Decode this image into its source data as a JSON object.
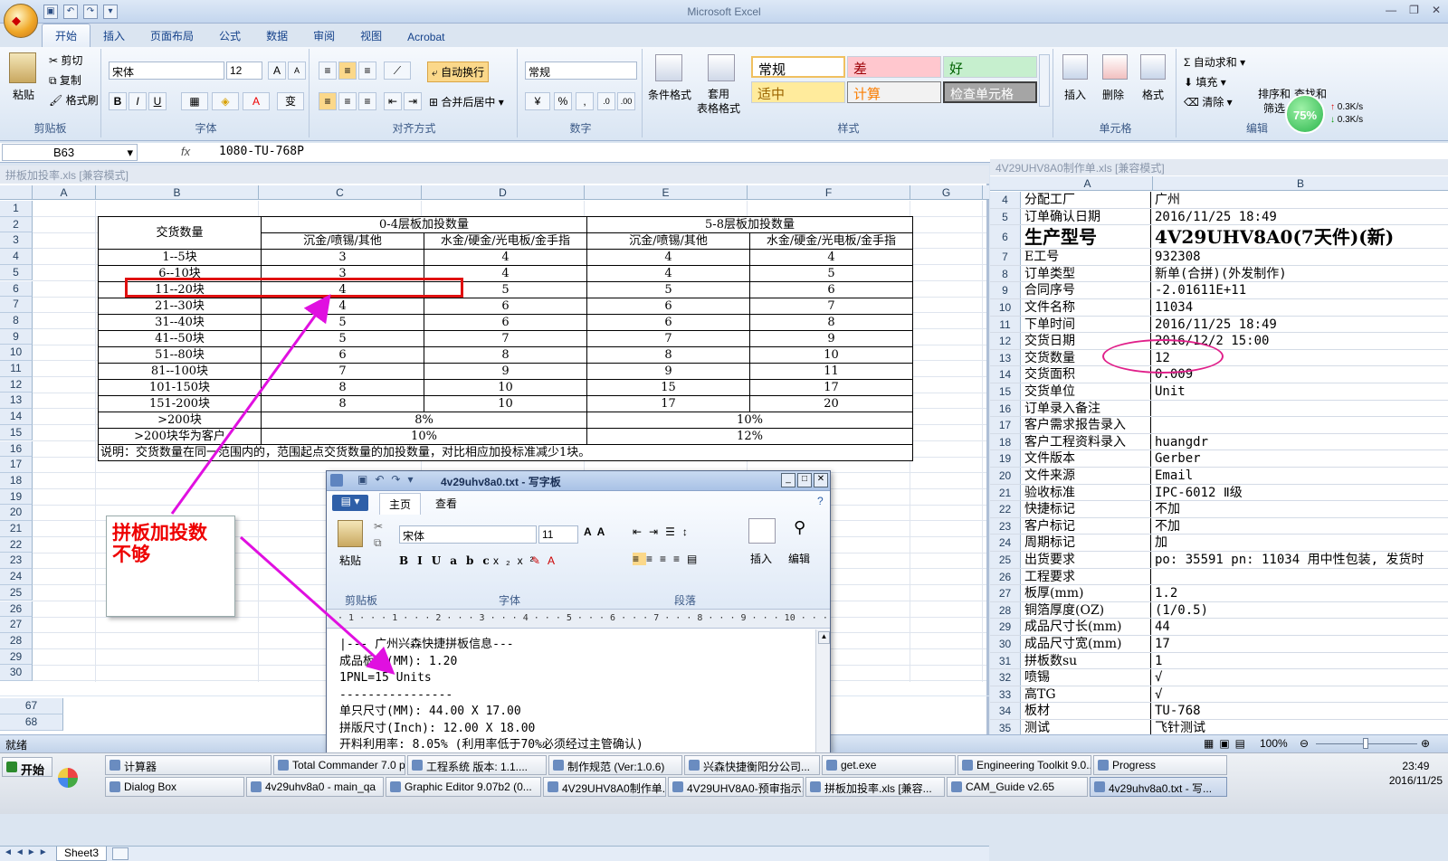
{
  "app": {
    "title": "Microsoft Excel",
    "office_button": "Office"
  },
  "ribbon": {
    "tabs": [
      "开始",
      "插入",
      "页面布局",
      "公式",
      "数据",
      "审阅",
      "视图",
      "Acrobat"
    ],
    "clipboard": {
      "paste": "粘贴",
      "cut": "剪切",
      "copy": "复制",
      "format_painter": "格式刷",
      "label": "剪贴板"
    },
    "font": {
      "name": "宋体",
      "size": "12",
      "label": "字体"
    },
    "alignment": {
      "wrap": "自动换行",
      "merge": "合并后居中",
      "label": "对齐方式"
    },
    "number": {
      "format": "常规",
      "label": "数字"
    },
    "styles": {
      "conditional": "条件格式",
      "table": "套用\n表格格式",
      "normal": "常规",
      "bad": "差",
      "good": "好",
      "neutral": "适中",
      "calc": "计算",
      "check": "检查单元格",
      "label": "样式"
    },
    "cells": {
      "insert": "插入",
      "delete": "删除",
      "format": "格式",
      "label": "单元格"
    },
    "editing": {
      "autosum": "自动求和",
      "fill": "填充",
      "clear": "清除",
      "sort": "排序和\n筛选",
      "find": "查找和\n选择",
      "label": "编辑"
    }
  },
  "net": {
    "percent": "75%",
    "up": "0.3K/s",
    "down": "0.3K/s"
  },
  "formula_bar": {
    "namebox": "B63",
    "fx": "fx",
    "value": "1080-TU-768P"
  },
  "left_workbook": {
    "title": "拼板加投率.xls  [兼容模式]",
    "columns": [
      "A",
      "B",
      "C",
      "D",
      "E",
      "F",
      "G"
    ],
    "rows": [
      "1",
      "2",
      "3",
      "4",
      "5",
      "6",
      "7",
      "8",
      "9",
      "10",
      "11",
      "12",
      "13",
      "14",
      "15",
      "16",
      "17",
      "18",
      "19",
      "20",
      "21",
      "22",
      "23",
      "24",
      "25",
      "26",
      "27",
      "28",
      "29",
      "30"
    ],
    "header": {
      "qty": "交货数量",
      "g1": "0-4层板加投数量",
      "g2": "5-8层板加投数量",
      "c1": "沉金/喷锡/其他",
      "c2": "水金/硬金/光电板/金手指",
      "c3": "沉金/喷锡/其他",
      "c4": "水金/硬金/光电板/金手指"
    },
    "table": [
      [
        "1--5块",
        "3",
        "4",
        "4",
        "4"
      ],
      [
        "6--10块",
        "3",
        "4",
        "4",
        "5"
      ],
      [
        "11--20块",
        "4",
        "5",
        "5",
        "6"
      ],
      [
        "21--30块",
        "4",
        "6",
        "6",
        "7"
      ],
      [
        "31--40块",
        "5",
        "6",
        "6",
        "8"
      ],
      [
        "41--50块",
        "5",
        "7",
        "7",
        "9"
      ],
      [
        "51--80块",
        "6",
        "8",
        "8",
        "10"
      ],
      [
        "81--100块",
        "7",
        "9",
        "9",
        "11"
      ],
      [
        "101-150块",
        "8",
        "10",
        "15",
        "17"
      ],
      [
        "151-200块",
        "8",
        "10",
        "17",
        "20"
      ]
    ],
    "row14": {
      "qty": ">200块",
      "g1": "8%",
      "g2": "10%"
    },
    "row15": {
      "qty": ">200块华为客户",
      "g1": "10%",
      "g2": "12%"
    },
    "note": "说明：交货数量在同一范围内的，范围起点交货数量的加投数量，对比相应加投标准减少1块。",
    "sheet_tab": "Sheet3",
    "lower_rows": [
      "67",
      "68"
    ]
  },
  "callout": {
    "text": "拼板加投数\n不够"
  },
  "right_workbook": {
    "title": "4V29UHV8A0制作单.xls  [兼容模式]",
    "columns": [
      "A",
      "B"
    ],
    "rows": [
      {
        "n": "4",
        "a": "分配工厂",
        "b": "广州"
      },
      {
        "n": "5",
        "a": "订单确认日期",
        "b": "2016/11/25 18:49"
      },
      {
        "n": "6",
        "a": "生产型号",
        "b": "4V29UHV8A0(7天件)(新)"
      },
      {
        "n": "7",
        "a": "E工号",
        "b": "932308"
      },
      {
        "n": "8",
        "a": "订单类型",
        "b": "新单(合拼)(外发制作)"
      },
      {
        "n": "9",
        "a": "合同序号",
        "b": "-2.01611E+11"
      },
      {
        "n": "10",
        "a": "文件名称",
        "b": "11034"
      },
      {
        "n": "11",
        "a": "下单时间",
        "b": "2016/11/25 18:49"
      },
      {
        "n": "12",
        "a": "交货日期",
        "b": "2016/12/2 15:00"
      },
      {
        "n": "13",
        "a": "交货数量",
        "b": "12"
      },
      {
        "n": "14",
        "a": "交货面积",
        "b": "0.009"
      },
      {
        "n": "15",
        "a": "交货单位",
        "b": "Unit"
      },
      {
        "n": "16",
        "a": "订单录入备注",
        "b": ""
      },
      {
        "n": "17",
        "a": "客户需求报告录入",
        "b": ""
      },
      {
        "n": "18",
        "a": "客户工程资料录入",
        "b": "huangdr"
      },
      {
        "n": "19",
        "a": "文件版本",
        "b": "Gerber"
      },
      {
        "n": "20",
        "a": "文件来源",
        "b": "Email"
      },
      {
        "n": "21",
        "a": "验收标准",
        "b": "IPC-6012 Ⅱ级"
      },
      {
        "n": "22",
        "a": "快捷标记",
        "b": "不加"
      },
      {
        "n": "23",
        "a": "客户标记",
        "b": "不加"
      },
      {
        "n": "24",
        "a": "周期标记",
        "b": "加"
      },
      {
        "n": "25",
        "a": "出货要求",
        "b": "po: 35591 pn: 11034 用中性包装, 发货时"
      },
      {
        "n": "26",
        "a": "工程要求",
        "b": ""
      },
      {
        "n": "27",
        "a": "板厚(mm)",
        "b": "1.2"
      },
      {
        "n": "28",
        "a": "铜箔厚度(OZ)",
        "b": " (1/0.5)"
      },
      {
        "n": "29",
        "a": "成品尺寸长(mm)",
        "b": "44"
      },
      {
        "n": "30",
        "a": "成品尺寸宽(mm)",
        "b": "17"
      },
      {
        "n": "31",
        "a": "拼板数su",
        "b": "1"
      },
      {
        "n": "32",
        "a": "喷锡",
        "b": "√"
      },
      {
        "n": "33",
        "a": "高TG",
        "b": "√"
      },
      {
        "n": "34",
        "a": "板材",
        "b": "TU-768"
      },
      {
        "n": "35",
        "a": "测试",
        "b": "飞针测试"
      }
    ]
  },
  "wordpad": {
    "title": "4v29uhv8a0.txt - 写字板",
    "tabs": [
      "主页",
      "查看"
    ],
    "paste": "粘贴",
    "font_name": "宋体",
    "font_size": "11",
    "insert": "插入",
    "edit": "编辑",
    "groups": [
      "剪贴板",
      "字体",
      "段落"
    ],
    "ruler": "· 1 · · · 1 · · · 2 · · · 3 · · · 4 · · · 5 · · · 6 · · · 7 · · · 8 · · · 9 · · · 10 · · · 11 · · · 12 · · · 13 · · · 14 ·",
    "doc": "|--- 广州兴森快捷拼板信息---\n成品板厚(MM): 1.20\n1PNL=15 Units\n----------------\n单只尺寸(MM): 44.00 X 17.00\n拼版尺寸(Inch): 12.00 X 18.00\n开料利用率: 8.05% (利用率低于70%必须经过主管确认)"
  },
  "statusbar": {
    "ready": "就绪",
    "zoom": "100%"
  },
  "taskbar": {
    "start": "开始",
    "row1": [
      "计算器",
      "Total Commander 7.0 p...",
      "工程系统  版本: 1.1....",
      "制作规范 (Ver:1.0.6)",
      "兴森快捷衡阳分公司...",
      "get.exe",
      "Engineering Toolkit 9.0...",
      "Progress"
    ],
    "row2": [
      "Dialog Box",
      "4v29uhv8a0 - main_qa",
      "Graphic Editor 9.07b2 (0...",
      "4V29UHV8A0制作单.xls...",
      "4V29UHV8A0-预审指示...",
      "拼板加投率.xls [兼容...",
      "CAM_Guide v2.65",
      "4v29uhv8a0.txt - 写..."
    ],
    "time": "23:49",
    "date": "2016/11/25"
  },
  "colors": {
    "highlight": "#e01010",
    "annotation": "#e010e0",
    "ellipse": "#e0208a"
  }
}
